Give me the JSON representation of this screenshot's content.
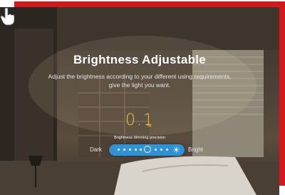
{
  "headline": "Brightness Adjustable",
  "subtitle_line1": "Adjust the brightness according to your different using requirements,",
  "subtitle_line2": "give the light you want.",
  "precision_value": "0.1",
  "precision_unit": "%",
  "precision_label": "Brightness dimming precision",
  "slider": {
    "min_label": "Dark",
    "max_label": "Bright",
    "level": 0.45
  },
  "colors": {
    "frame_accent": "#d3181c",
    "slider": "#2b93d6",
    "precision_value": "#e5c24a"
  },
  "icons": [
    "sun-icon",
    "hand-pointer-icon"
  ]
}
